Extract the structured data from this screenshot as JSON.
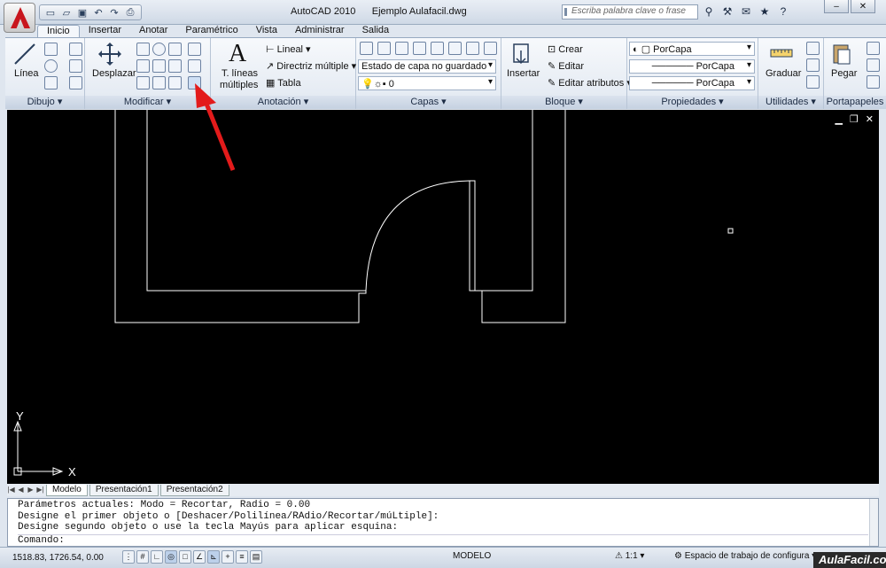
{
  "window": {
    "app_title": "AutoCAD 2010",
    "doc_title": "Ejemplo Aulafacil.dwg",
    "search_placeholder": "Escriba palabra clave o frase"
  },
  "tabs": [
    "Inicio",
    "Insertar",
    "Anotar",
    "Paramétrico",
    "Vista",
    "Administrar",
    "Salida"
  ],
  "ribbon": {
    "dibujo": {
      "title": "Dibujo",
      "linea": "Línea"
    },
    "modificar": {
      "title": "Modificar",
      "desplazar": "Desplazar"
    },
    "anotacion": {
      "title": "Anotación",
      "tlineas_1": "T. líneas",
      "tlineas_2": "múltiples",
      "lineal": "Lineal",
      "directriz": "Directriz múltiple",
      "tabla": "Tabla"
    },
    "capas": {
      "title": "Capas",
      "estado": "Estado de capa no guardado",
      "layer": "0"
    },
    "bloque": {
      "title": "Bloque",
      "insertar": "Insertar",
      "crear": "Crear",
      "editar": "Editar",
      "editar_atributos": "Editar atributos"
    },
    "propiedades": {
      "title": "Propiedades",
      "color": "PorCapa",
      "linetype": "PorCapa",
      "lineweight": "PorCapa"
    },
    "utilidades": {
      "title": "Utilidades",
      "graduar": "Graduar"
    },
    "portapapeles": {
      "title": "Portapapeles",
      "pegar": "Pegar"
    }
  },
  "ucs": {
    "x": "X",
    "y": "Y"
  },
  "layout_tabs": [
    "Modelo",
    "Presentación1",
    "Presentación2"
  ],
  "command_lines": [
    "Parámetros actuales: Modo = Recortar, Radio = 0.00",
    "Designe el primer objeto o [Deshacer/Polilínea/RAdio/Recortar/múLtiple]:",
    "Designe segundo objeto o use la tecla Mayús para aplicar esquina:"
  ],
  "command_prompt": "Comando:",
  "status": {
    "coords": "1518.83, 1726.54, 0.00",
    "modelo": "MODELO",
    "scale": "1:1",
    "workspace": "Espacio de trabajo de configura"
  },
  "watermark": "AulaFacil.com",
  "colors": {
    "canvas": "#000000",
    "arrow": "#e31b1b",
    "accent": "#c8161d"
  }
}
